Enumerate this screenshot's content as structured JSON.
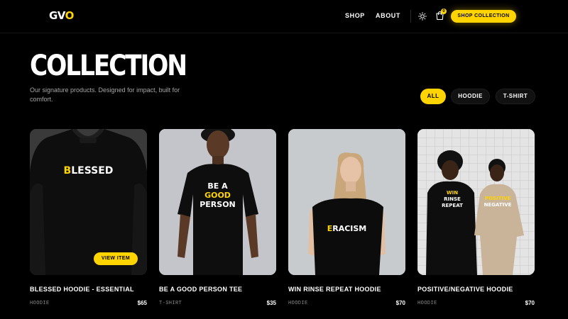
{
  "brand": {
    "logo_prefix": "GV",
    "logo_accent": "O"
  },
  "nav": {
    "links": [
      "SHOP",
      "ABOUT"
    ],
    "cart_count": "0",
    "cta_label": "SHOP COLLECTION",
    "icons": [
      "sun-icon",
      "cart-icon"
    ]
  },
  "hero": {
    "title": "COLLECTION",
    "description": "Our signature products. Designed for impact, built for comfort."
  },
  "filters": [
    {
      "label": "ALL",
      "active": true
    },
    {
      "label": "HOODIE",
      "active": false
    },
    {
      "label": "T-SHIRT",
      "active": false
    }
  ],
  "products": [
    {
      "name": "BLESSED HOODIE - ESSENTIAL",
      "category": "HOODIE",
      "price": "$65",
      "print_accent": "B",
      "print_rest": "LESSED",
      "button": "VIEW ITEM"
    },
    {
      "name": "BE A GOOD PERSON TEE",
      "category": "T-SHIRT",
      "price": "$35",
      "print_line1": "BE A",
      "print_line2": "GOOD",
      "print_line3": "PERSON"
    },
    {
      "name": "WIN RINSE REPEAT HOODIE",
      "category": "HOODIE",
      "price": "$70",
      "print_accent": "E",
      "print_rest": "RACISM"
    },
    {
      "name": "POSITIVE/NEGATIVE HOODIE",
      "category": "HOODIE",
      "price": "$70",
      "print_a1": "WIN",
      "print_a2": "RINSE",
      "print_a3": "REPEAT",
      "print_b1": "POSITIVE",
      "print_b2": "NEGATIVE"
    }
  ],
  "colors": {
    "accent": "#ffd400",
    "background": "#000000"
  }
}
